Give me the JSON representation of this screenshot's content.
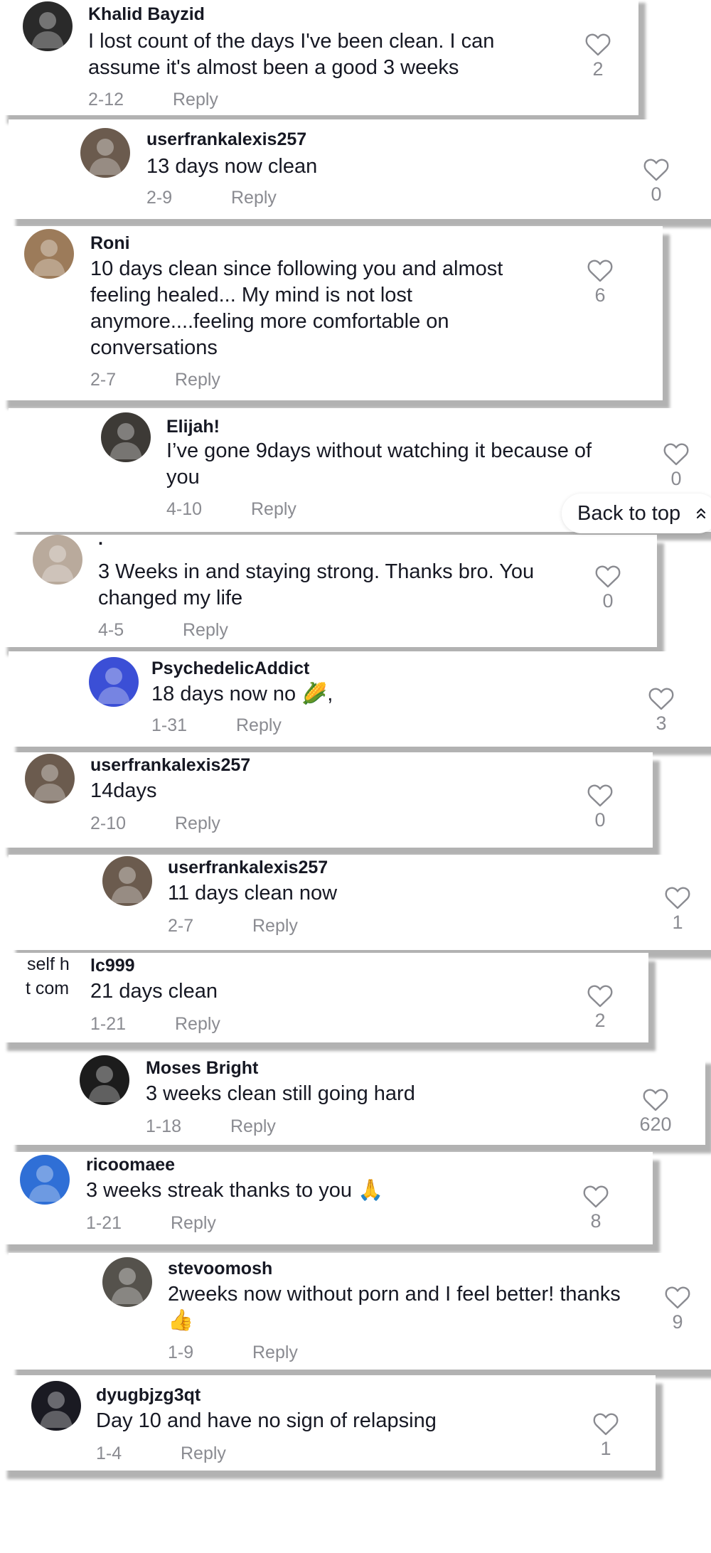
{
  "back_to_top": {
    "label": "Back to top",
    "icon": "double-chevron-up-icon"
  },
  "fragment": {
    "line1": "self h",
    "line2": "t com"
  },
  "comments": [
    {
      "username": "Khalid Bayzid",
      "text": "I lost count of the days I've been clean. I can assume it's almost been a good 3 weeks",
      "date": "2-12",
      "reply": "Reply",
      "likes": "2",
      "avatar_color": "#2a2a2a"
    },
    {
      "username": "userfrankalexis257",
      "text": "13 days now clean",
      "date": "2-9",
      "reply": "Reply",
      "likes": "0",
      "avatar_color": "#6b5b4e"
    },
    {
      "username": "Roni",
      "text": "10 days clean since following you and almost feeling healed... My mind is not lost anymore....feeling more comfortable on conversations",
      "date": "2-7",
      "reply": "Reply",
      "likes": "6",
      "avatar_color": "#9c7b5a"
    },
    {
      "username": "Elijah!",
      "text": "I’ve gone 9days without watching it because of you",
      "date": "4-10",
      "reply": "Reply",
      "likes": "0",
      "avatar_color": "#3d3a36"
    },
    {
      "username": ".",
      "text": "3 Weeks in and staying strong. Thanks bro. You changed my life",
      "date": "4-5",
      "reply": "Reply",
      "likes": "0",
      "avatar_color": "#b9aa9c"
    },
    {
      "username": "PsychedelicAddict",
      "text": "18 days now no 🌽,",
      "date": "1-31",
      "reply": "Reply",
      "likes": "3",
      "avatar_color": "#3b4fd6"
    },
    {
      "username": "userfrankalexis257",
      "text": "14days",
      "date": "2-10",
      "reply": "Reply",
      "likes": "0",
      "avatar_color": "#6b5b4e"
    },
    {
      "username": "userfrankalexis257",
      "text": "11 days clean now",
      "date": "2-7",
      "reply": "Reply",
      "likes": "1",
      "avatar_color": "#6b5b4e"
    },
    {
      "username": "lc999",
      "text": "21 days clean",
      "date": "1-21",
      "reply": "Reply",
      "likes": "2",
      "avatar_color": "#ffffff"
    },
    {
      "username": "Moses Bright",
      "text": "3 weeks clean still going hard",
      "date": "1-18",
      "reply": "Reply",
      "likes": "620",
      "avatar_color": "#1c1c1c"
    },
    {
      "username": "ricoomaee",
      "text": "3 weeks streak thanks to you 🙏",
      "date": "1-21",
      "reply": "Reply",
      "likes": "8",
      "avatar_color": "#2f6fd6"
    },
    {
      "username": "stevoomosh",
      "text": "2weeks now without porn and I feel better! thanks 👍",
      "date": "1-9",
      "reply": "Reply",
      "likes": "9",
      "avatar_color": "#55524c"
    },
    {
      "username": "dyugbjzg3qt",
      "text": "Day 10 and have no sign of relapsing",
      "date": "1-4",
      "reply": "Reply",
      "likes": "1",
      "avatar_color": "#1a1a22"
    }
  ]
}
